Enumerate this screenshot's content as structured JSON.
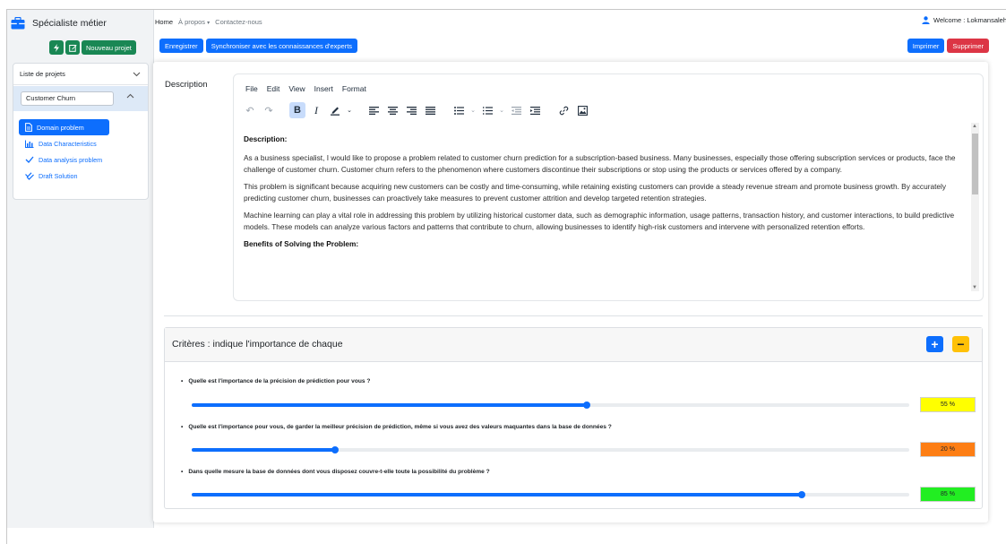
{
  "app": {
    "title": "Spécialiste métier"
  },
  "sidebar": {
    "action_icons": [
      "bolt-icon",
      "edit-icon"
    ],
    "new_project_label": "Nouveau projet",
    "projects_list_label": "Liste de projets",
    "selected_project": "Customer Churn",
    "nav": [
      {
        "label": "Domain problem",
        "icon": "document-icon",
        "active": true
      },
      {
        "label": "Data Characteristics",
        "icon": "bar-chart-icon",
        "active": false
      },
      {
        "label": "Data analysis problem",
        "icon": "check-icon",
        "active": false
      },
      {
        "label": "Draft Solution",
        "icon": "double-check-icon",
        "active": false
      }
    ]
  },
  "topnav": {
    "home": "Home",
    "about": "À propos",
    "contact": "Contactez-nous",
    "welcome": "Welcome : Lokmansaleh"
  },
  "toolbar": {
    "save": "Enregistrer",
    "sync": "Synchroniser avec les connaissances d'experts",
    "print": "Imprimer",
    "delete": "Supprimer"
  },
  "editor": {
    "label": "Description",
    "menu": [
      "File",
      "Edit",
      "View",
      "Insert",
      "Format"
    ],
    "content": {
      "heading": "Description:",
      "paragraphs": [
        "As a business specialist, I would like to propose a problem related to customer churn prediction for a subscription-based business. Many businesses, especially those offering subscription services or products, face the challenge of customer churn. Customer churn refers to the phenomenon where customers discontinue their subscriptions or stop using the products or services offered by a company.",
        "This problem is significant because acquiring new customers can be costly and time-consuming, while retaining existing customers can provide a steady revenue stream and promote business growth. By accurately predicting customer churn, businesses can proactively take measures to prevent customer attrition and develop targeted retention strategies.",
        "Machine learning can play a vital role in addressing this problem by utilizing historical customer data, such as demographic information, usage patterns, transaction history, and customer interactions, to build predictive models. These models can analyze various factors and patterns that contribute to churn, allowing businesses to identify high-risk customers and intervene with personalized retention efforts."
      ],
      "subheading": "Benefits of Solving the Problem:"
    }
  },
  "criteria": {
    "title": "Critères : indique l'importance de chaque",
    "add_label": "+",
    "remove_label": "−",
    "items": [
      {
        "question": "Quelle est l'importance de la précision de prédiction pour vous ?",
        "value": 55,
        "value_text": "55 %",
        "color": "#ffff00"
      },
      {
        "question": "Quelle est l'importance pour vous, de garder la meilleur précision de prédiction, même si vous avez des valeurs maquantes dans la base de données ?",
        "value": 20,
        "value_text": "20 %",
        "color": "#fd7e14"
      },
      {
        "question": "Dans quelle mesure la base de données dont vous disposez couvre-t-elle toute la possibilité du problème ?",
        "value": 85,
        "value_text": "85 %",
        "color": "#22ee22"
      }
    ]
  },
  "colors": {
    "primary": "#0d6efd",
    "success": "#198754",
    "danger": "#dc3545",
    "warning": "#ffc107"
  }
}
